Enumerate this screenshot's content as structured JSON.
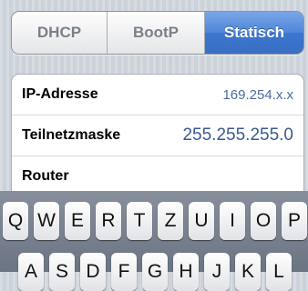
{
  "segmented": {
    "items": [
      {
        "label": "DHCP",
        "active": false
      },
      {
        "label": "BootP",
        "active": false
      },
      {
        "label": "Statisch",
        "active": true
      }
    ],
    "active_color": "#3b76cf"
  },
  "settings": {
    "rows": [
      {
        "label": "IP-Adresse",
        "value": "169.254.x.x"
      },
      {
        "label": "Teilnetzmaske",
        "value": "255.255.255.0"
      },
      {
        "label": "Router",
        "value": ""
      }
    ]
  },
  "keyboard": {
    "row1": [
      "Q",
      "W",
      "E",
      "R",
      "T",
      "Z",
      "U",
      "I",
      "O",
      "P"
    ],
    "row2": [
      "A",
      "S",
      "D",
      "F",
      "G",
      "H",
      "J",
      "K",
      "L"
    ]
  }
}
